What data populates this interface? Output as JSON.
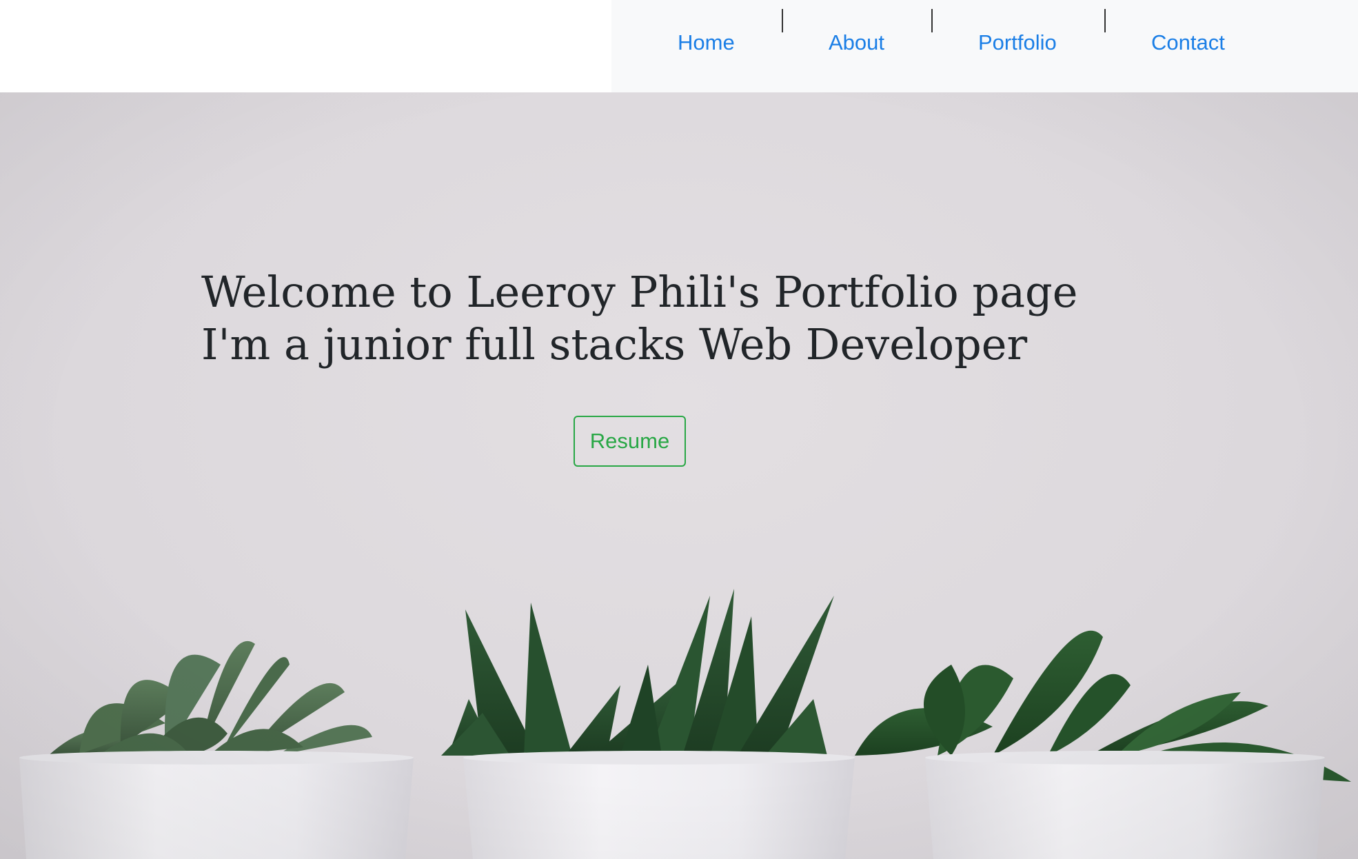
{
  "nav": {
    "items": [
      {
        "label": "Home"
      },
      {
        "label": "About"
      },
      {
        "label": "Portfolio"
      },
      {
        "label": "Contact"
      }
    ],
    "link_color": "#1a7ee6",
    "background": "#f8f9fa"
  },
  "hero": {
    "headline_line1": "Welcome to Leeroy Phili's Portfolio page",
    "headline_line2": "I'm a junior full stacks Web Developer",
    "resume_label": "Resume",
    "button_color": "#28a745",
    "text_color": "#212529"
  }
}
